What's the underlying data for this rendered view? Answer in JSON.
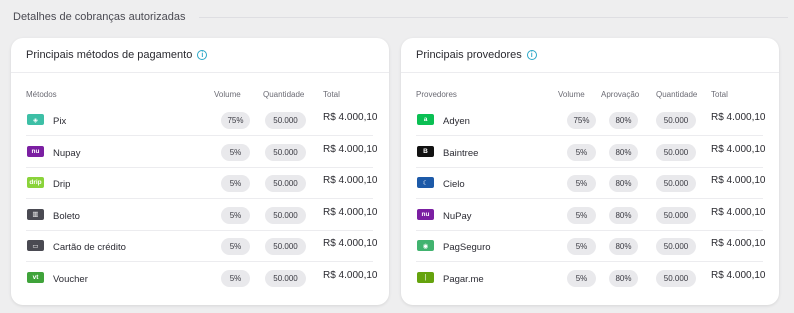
{
  "section": {
    "title": "Detalhes de cobranças autorizadas"
  },
  "left": {
    "title": "Principais métodos de pagamento",
    "columns": {
      "name": "Métodos",
      "volume": "Volume",
      "quantity": "Quantidade",
      "total": "Total"
    },
    "rows": [
      {
        "name": "Pix",
        "volume": "75%",
        "quantity": "50.000",
        "total": "R$ 4.000,10",
        "icon": "pix-icon",
        "color": "#3dbfa6",
        "glyph": "◈"
      },
      {
        "name": "Nupay",
        "volume": "5%",
        "quantity": "50.000",
        "total": "R$ 4.000,10",
        "icon": "nupay-icon",
        "color": "#7b1fa2",
        "glyph": "nu"
      },
      {
        "name": "Drip",
        "volume": "5%",
        "quantity": "50.000",
        "total": "R$ 4.000,10",
        "icon": "drip-icon",
        "color": "#8ad33a",
        "glyph": "drip"
      },
      {
        "name": "Boleto",
        "volume": "5%",
        "quantity": "50.000",
        "total": "R$ 4.000,10",
        "icon": "boleto-icon",
        "color": "#4a4a52",
        "glyph": "▥"
      },
      {
        "name": "Cartão de crédito",
        "volume": "5%",
        "quantity": "50.000",
        "total": "R$ 4.000,10",
        "icon": "credit-card-icon",
        "color": "#4a4a52",
        "glyph": "▭"
      },
      {
        "name": "Voucher",
        "volume": "5%",
        "quantity": "50.000",
        "total": "R$ 4.000,10",
        "icon": "voucher-icon",
        "color": "#3fa33a",
        "glyph": "vt"
      }
    ]
  },
  "right": {
    "title": "Principais provedores",
    "columns": {
      "name": "Provedores",
      "volume": "Volume",
      "approval": "Aprovação",
      "quantity": "Quantidade",
      "total": "Total"
    },
    "rows": [
      {
        "name": "Adyen",
        "volume": "75%",
        "approval": "80%",
        "quantity": "50.000",
        "total": "R$ 4.000,10",
        "icon": "adyen-icon",
        "color": "#0abf53",
        "glyph": "a"
      },
      {
        "name": "Baintree",
        "volume": "5%",
        "approval": "80%",
        "quantity": "50.000",
        "total": "R$ 4.000,10",
        "icon": "braintree-icon",
        "color": "#111111",
        "glyph": "B"
      },
      {
        "name": "Cielo",
        "volume": "5%",
        "approval": "80%",
        "quantity": "50.000",
        "total": "R$ 4.000,10",
        "icon": "cielo-icon",
        "color": "#1d5aa8",
        "glyph": "☾"
      },
      {
        "name": "NuPay",
        "volume": "5%",
        "approval": "80%",
        "quantity": "50.000",
        "total": "R$ 4.000,10",
        "icon": "nupay-icon",
        "color": "#7b1fa2",
        "glyph": "nu"
      },
      {
        "name": "PagSeguro",
        "volume": "5%",
        "approval": "80%",
        "quantity": "50.000",
        "total": "R$ 4.000,10",
        "icon": "pagseguro-icon",
        "color": "#41b36f",
        "glyph": "◉"
      },
      {
        "name": "Pagar.me",
        "volume": "5%",
        "approval": "80%",
        "quantity": "50.000",
        "total": "R$ 4.000,10",
        "icon": "pagarme-icon",
        "color": "#65a30d",
        "glyph": "❘"
      }
    ]
  }
}
